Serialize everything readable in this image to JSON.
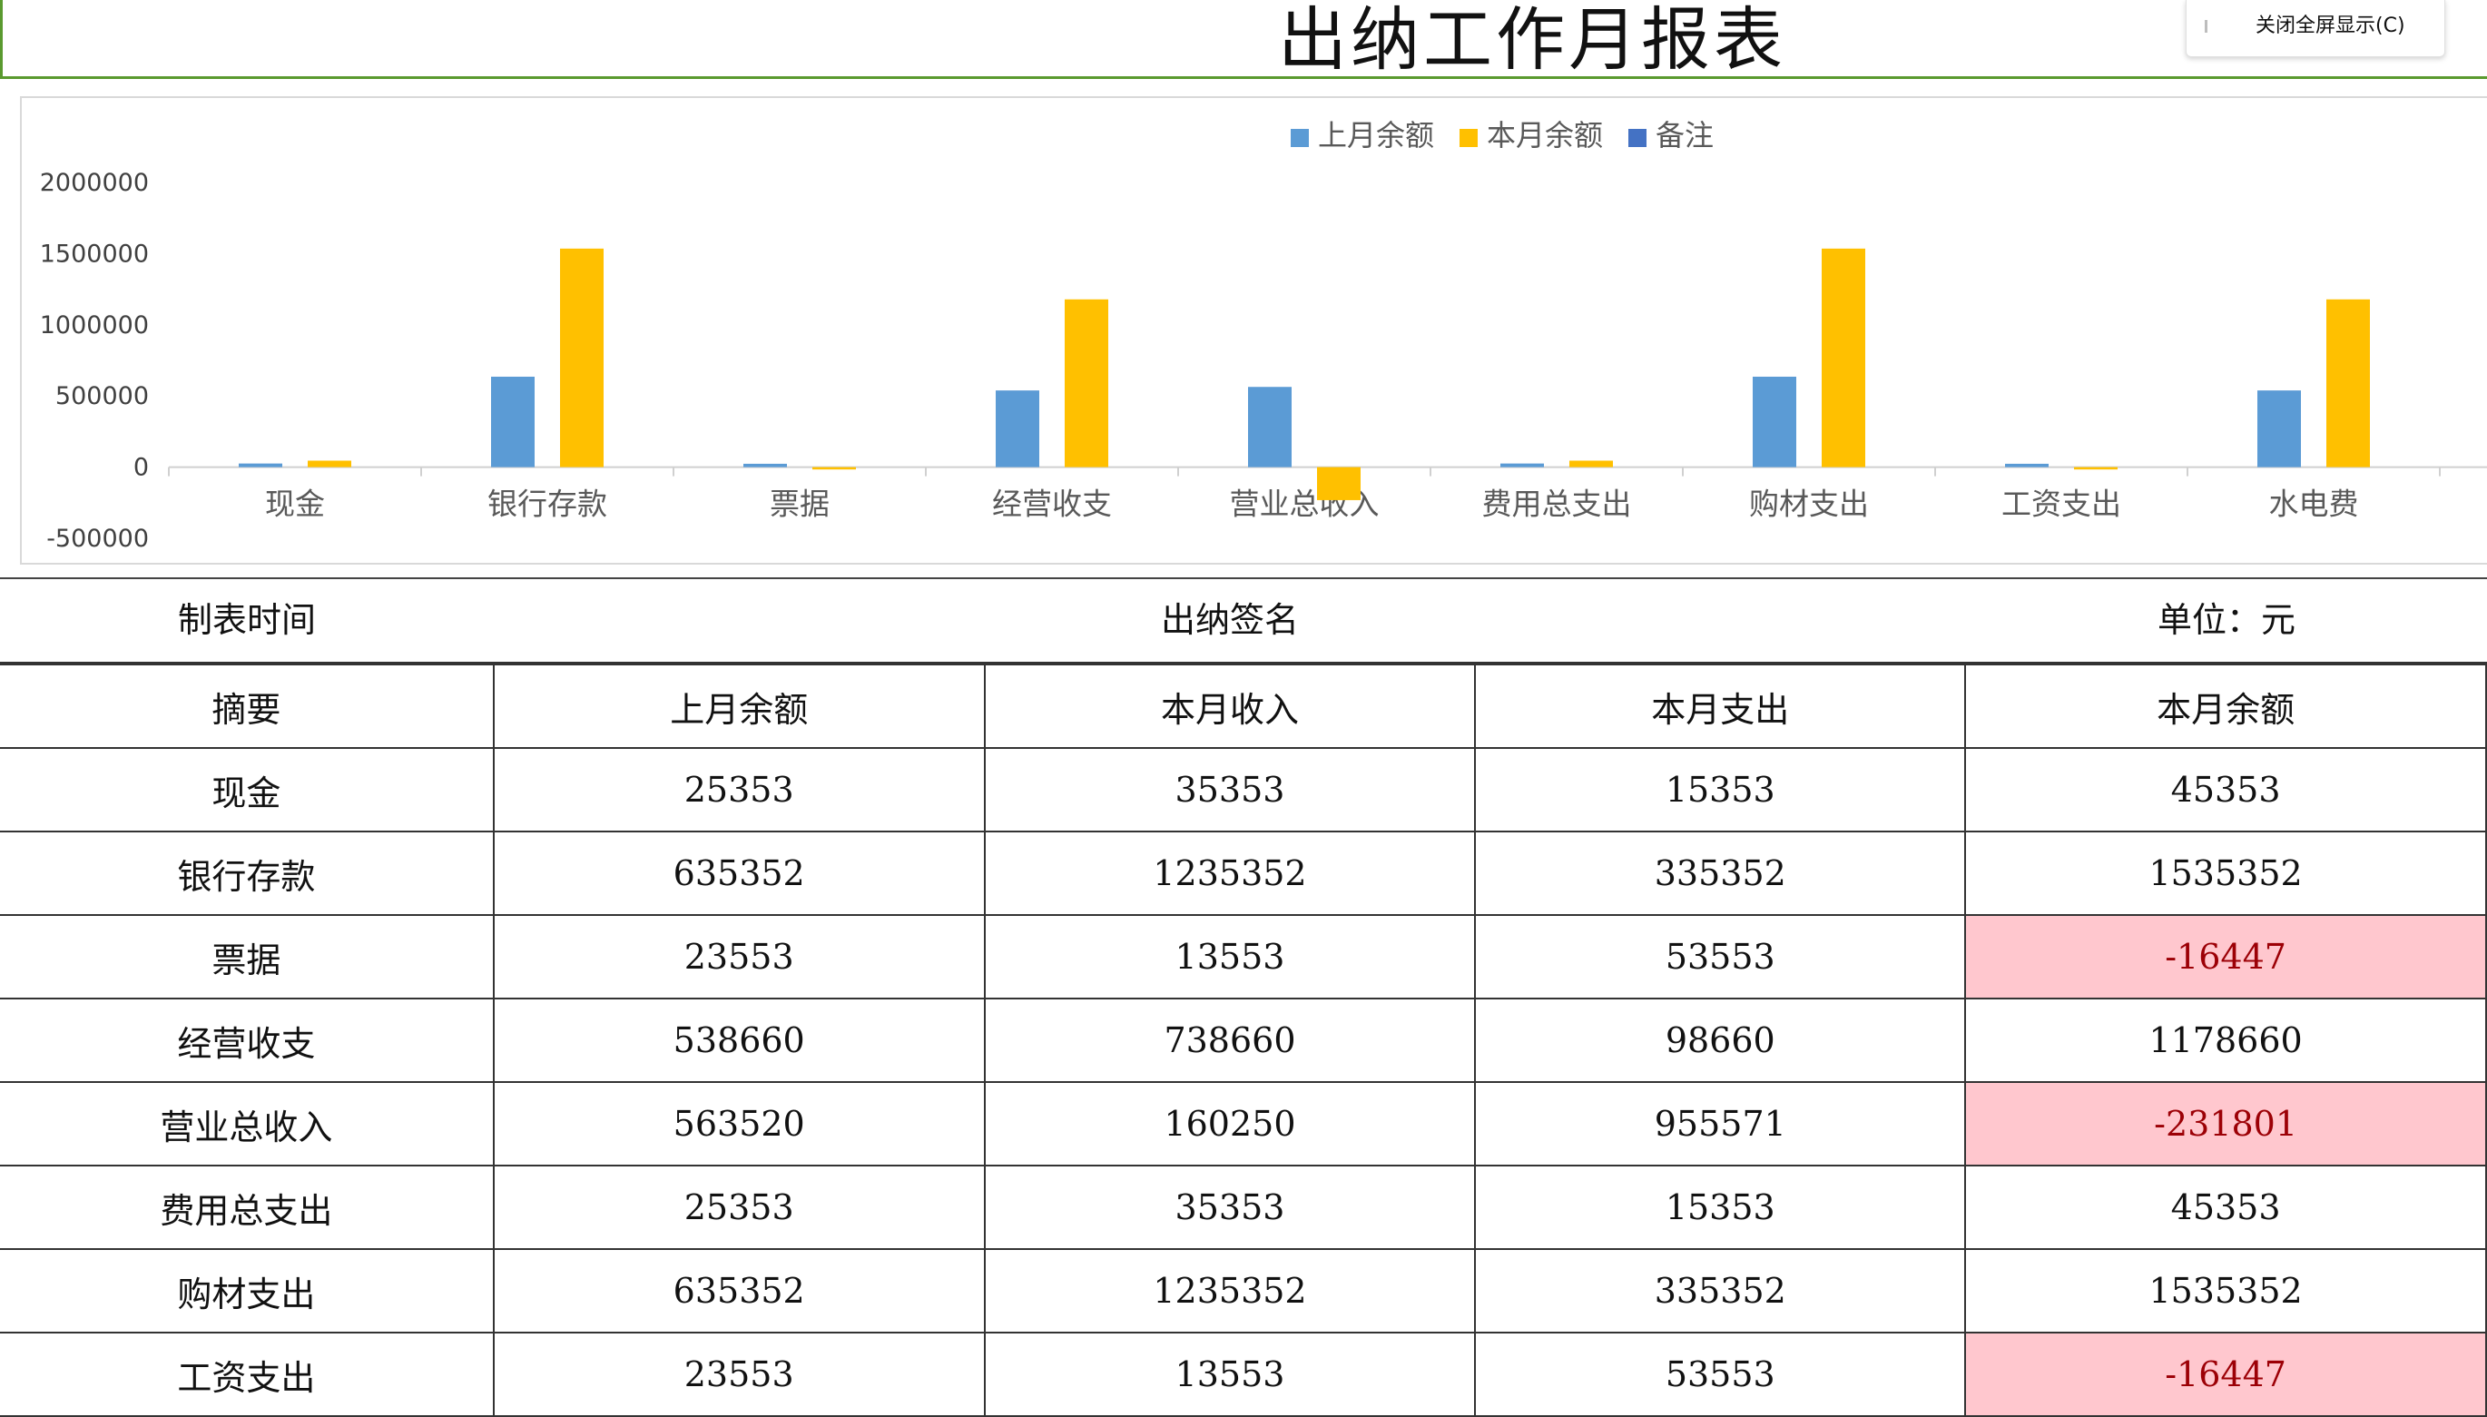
{
  "page": {
    "title": "出纳工作月报表",
    "fullscreen_button": "关闭全屏显示(C)"
  },
  "chart_data": {
    "type": "bar",
    "categories": [
      "现金",
      "银行存款",
      "票据",
      "经营收支",
      "营业总收入",
      "费用总支出",
      "购材支出",
      "工资支出",
      "水电费"
    ],
    "series": [
      {
        "name": "上月余额",
        "color": "#5b9bd5",
        "values": [
          25353,
          635352,
          23553,
          538660,
          563520,
          25353,
          635352,
          23553,
          538660
        ]
      },
      {
        "name": "本月余额",
        "color": "#ffc000",
        "values": [
          45353,
          1535352,
          -16447,
          1178660,
          -231801,
          45353,
          1535352,
          -16447,
          1178660
        ]
      },
      {
        "name": "备注",
        "color": "#4472c4",
        "values": []
      }
    ],
    "y_ticks": [
      "2000000",
      "1500000",
      "1000000",
      "500000",
      "0",
      "-500000"
    ],
    "ylim": [
      -500000,
      2000000
    ],
    "legend_position": "top",
    "grid": false
  },
  "info": {
    "time_label": "制表时间",
    "signature_label": "出纳签名",
    "unit_label": "单位：元"
  },
  "table": {
    "headers": [
      "摘要",
      "上月余额",
      "本月收入",
      "本月支出",
      "本月余额"
    ],
    "rows": [
      [
        "现金",
        "25353",
        "35353",
        "15353",
        "45353"
      ],
      [
        "银行存款",
        "635352",
        "1235352",
        "335352",
        "1535352"
      ],
      [
        "票据",
        "23553",
        "13553",
        "53553",
        "-16447"
      ],
      [
        "经营收支",
        "538660",
        "738660",
        "98660",
        "1178660"
      ],
      [
        "营业总收入",
        "563520",
        "160250",
        "955571",
        "-231801"
      ],
      [
        "费用总支出",
        "25353",
        "35353",
        "15353",
        "45353"
      ],
      [
        "购材支出",
        "635352",
        "1235352",
        "335352",
        "1535352"
      ],
      [
        "工资支出",
        "23553",
        "13553",
        "53553",
        "-16447"
      ]
    ]
  }
}
